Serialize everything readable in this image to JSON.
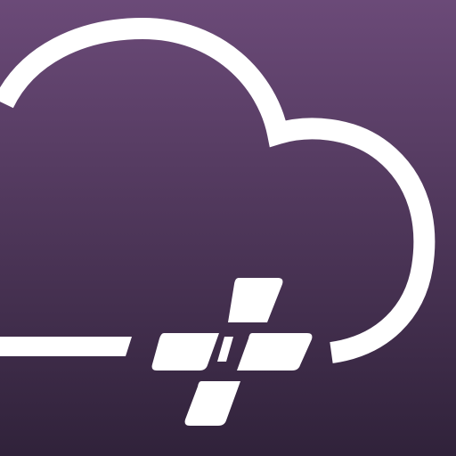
{
  "icon": {
    "name": "cloud-plus-app-icon",
    "background_top": "#6b4a78",
    "background_bottom": "#30223a",
    "foreground": "#ffffff"
  }
}
